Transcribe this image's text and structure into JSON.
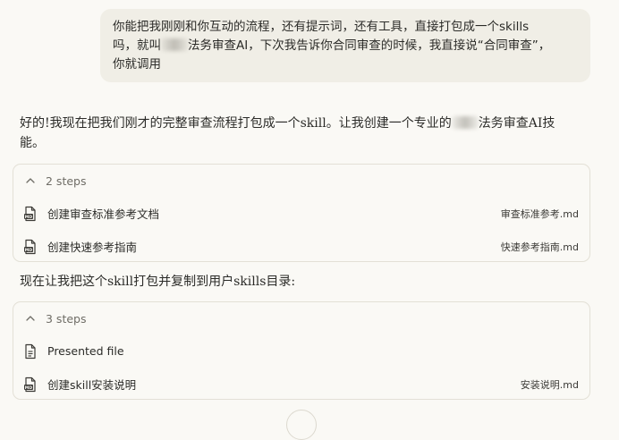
{
  "user_message": {
    "line1": "你能把我刚刚和你互动的流程，还有提示词，还有工具，直接打包成一个skills",
    "line2_a": "吗，就叫",
    "line2_b": "法务审查AI，下次我告诉你合同审查的时候，我直接说“合同审查”，",
    "line3": "你就调用"
  },
  "assistant": {
    "para1_a": "好的!我现在把我们刚才的完整审查流程打包成一个skill。让我创建一个专业的",
    "para1_b": "法务审查AI技",
    "para1_c": "能。",
    "para2": "现在让我把这个skill打包并复制到用户skills目录:"
  },
  "steps_block_1": {
    "header": "2 steps",
    "steps": [
      {
        "label": "创建审查标准参考文档",
        "file": "审查标准参考.md",
        "icon": "md-file-icon"
      },
      {
        "label": "创建快速参考指南",
        "file": "快速参考指南.md",
        "icon": "md-file-icon"
      }
    ]
  },
  "steps_block_2": {
    "header": "3 steps",
    "steps": [
      {
        "label": "Presented file",
        "file": "",
        "icon": "document-icon"
      },
      {
        "label": "创建skill安装说明",
        "file": "安装说明.md",
        "icon": "md-file-icon"
      }
    ]
  }
}
